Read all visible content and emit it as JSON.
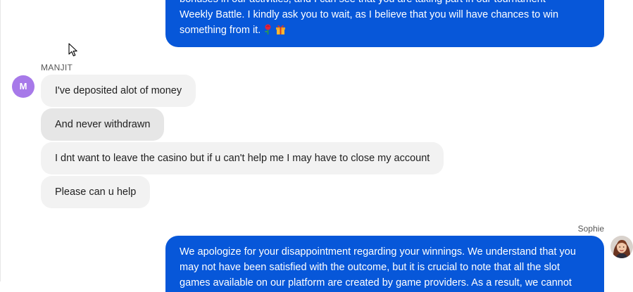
{
  "chat": {
    "agent_message_1": {
      "lines": [
        "bonuses in our activities, and I can see that you are taking part in our tournament",
        "Weekly Battle. I kindly ask you to wait, as I believe that you will have chances to win",
        "something from it."
      ],
      "emoji_icons": [
        "rose-icon",
        "gift-icon"
      ]
    },
    "user": {
      "sender_name": "MANJIT",
      "avatar_initial": "M",
      "avatar_color": "#a779e9",
      "messages": [
        "I've deposited alot of money",
        "And never withdrawn",
        "I dnt want to leave the casino but if u can't help me I may have to close my account",
        "Please can u help"
      ]
    },
    "agent": {
      "sender_name": "Sophie",
      "bubble_color": "#0757d9",
      "avatar_icon": "agent-photo-avatar"
    },
    "agent_message_2": {
      "lines": [
        "We apologize for your disappointment regarding your winnings. We understand that you",
        "may not have been satisfied with the outcome, but it is crucial to note that all the slot",
        "games available on our platform are created by game providers. As a result, we cannot"
      ]
    }
  }
}
